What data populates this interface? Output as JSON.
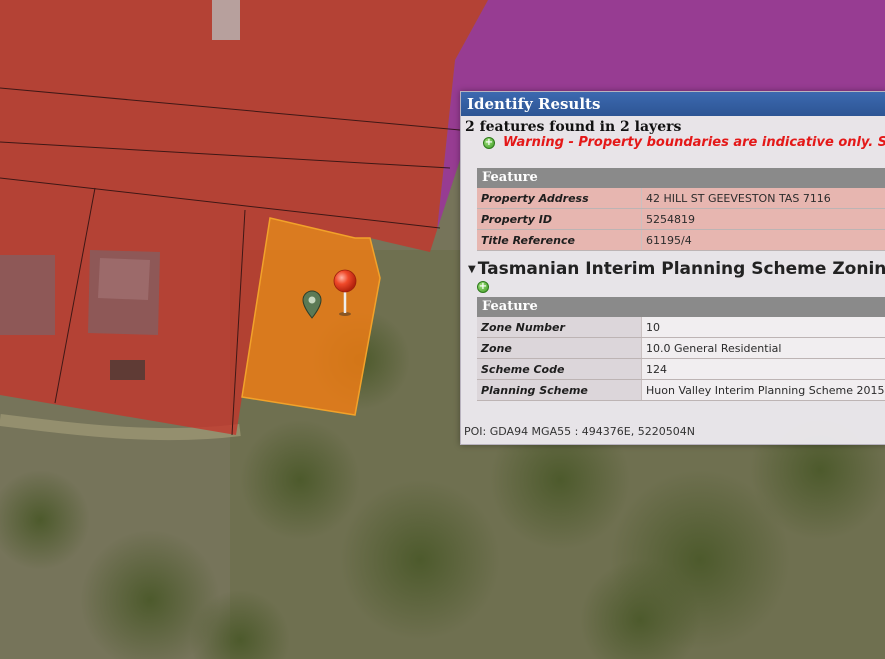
{
  "popup": {
    "title": "Identify Results",
    "summary": "2 features found in 2 layers",
    "warning": "Warning - Property boundaries are indicative only. Se",
    "layer1": {
      "header": "Feature",
      "rows": [
        {
          "key": "Property Address",
          "value": "42 HILL ST GEEVESTON TAS 7116"
        },
        {
          "key": "Property ID",
          "value": "5254819"
        },
        {
          "key": "Title Reference",
          "value": "61195/4"
        }
      ]
    },
    "layer2": {
      "title": "Tasmanian Interim Planning Scheme Zoning (on",
      "header": "Feature",
      "rows": [
        {
          "key": "Zone Number",
          "value": "10"
        },
        {
          "key": "Zone",
          "value": "10.0 General Residential"
        },
        {
          "key": "Scheme Code",
          "value": "124"
        },
        {
          "key": "Planning Scheme",
          "value": "Huon Valley Interim Planning Scheme 2015"
        }
      ]
    },
    "poi": "POI: GDA94 MGA55 : 494376E, 5220504N"
  },
  "colors": {
    "residential_zone": "#c0392b",
    "purple_zone": "#a020a0",
    "selected_parcel": "#ff8c00",
    "title_bar": "#2d5594",
    "warning_text": "#e41818"
  },
  "icons": {
    "poi_marker": "red-pin-icon",
    "location_marker": "green-location-icon",
    "expand": "plus-icon",
    "collapse": "caret-down-icon"
  }
}
